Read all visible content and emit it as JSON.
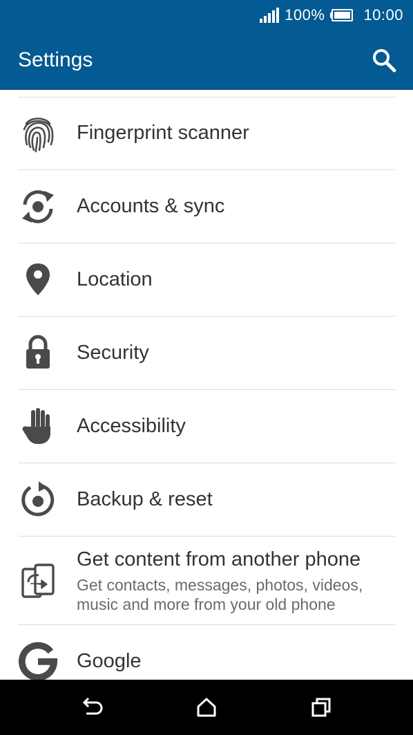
{
  "status_bar": {
    "battery_percent": "100%",
    "time": "10:00"
  },
  "app_bar": {
    "title": "Settings",
    "search_icon": "search-icon"
  },
  "settings_items": [
    {
      "label": "Fingerprint scanner",
      "icon": "fingerprint-icon"
    },
    {
      "label": "Accounts & sync",
      "icon": "sync-icon"
    },
    {
      "label": "Location",
      "icon": "location-pin-icon"
    },
    {
      "label": "Security",
      "icon": "lock-icon"
    },
    {
      "label": "Accessibility",
      "icon": "hand-icon"
    },
    {
      "label": "Backup & reset",
      "icon": "backup-icon"
    },
    {
      "label": "Get content from another phone",
      "subtitle_line1": "Get contacts, messages, photos, videos,",
      "subtitle_line2": "music and more from your old phone",
      "icon": "transfer-phone-icon"
    },
    {
      "label": "Google",
      "icon": "google-icon"
    }
  ],
  "nav_bar": {
    "back_icon": "back-icon",
    "home_icon": "home-icon",
    "recents_icon": "recents-icon"
  },
  "colors": {
    "header": "#045a92",
    "icon": "#4a4a4a",
    "text": "#333333",
    "divider": "#dcdcdc"
  }
}
